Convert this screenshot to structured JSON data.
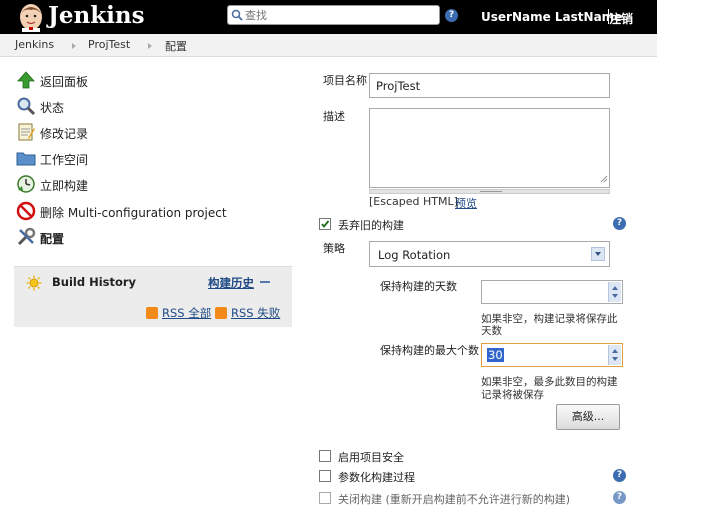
{
  "header": {
    "app_title": "Jenkins",
    "search_placeholder": "查找",
    "user_name": "UserName LastName",
    "logout_label": "注销"
  },
  "breadcrumb": [
    "Jenkins",
    "ProjTest",
    "配置"
  ],
  "sidebar": {
    "items": [
      {
        "label": "返回面板",
        "icon": "up-arrow-icon"
      },
      {
        "label": "状态",
        "icon": "magnifier-icon"
      },
      {
        "label": "修改记录",
        "icon": "notepad-icon"
      },
      {
        "label": "工作空间",
        "icon": "folder-icon"
      },
      {
        "label": "立即构建",
        "icon": "build-clock-icon"
      },
      {
        "label": "删除 Multi-configuration project",
        "icon": "no-entry-icon"
      },
      {
        "label": "配置",
        "icon": "tools-icon"
      }
    ]
  },
  "build_history": {
    "title": "Build History",
    "link_label": "构建历史",
    "rss_all": "RSS 全部",
    "rss_failed": "RSS 失败"
  },
  "form": {
    "project_name_label": "项目名称",
    "project_name_value": "ProjTest",
    "description_label": "描述",
    "description_value": "",
    "escaped_html": "[Escaped HTML]",
    "preview_link": "预览",
    "discard_old_label": "丢弃旧的构建",
    "discard_old_checked": true,
    "strategy_label": "策略",
    "strategy_value": "Log Rotation",
    "days_label": "保持构建的天数",
    "days_value": "",
    "days_note_1": "如果非空，构建记录将保存此",
    "days_note_2": "天数",
    "max_label": "保持构建的最大个数",
    "max_value": "30",
    "max_note_1": "如果非空，最多此数目的构建",
    "max_note_2": "记录将被保存",
    "advanced_button": "高级...",
    "enable_security_label": "启用项目安全",
    "parameterized_label": "参数化构建过程",
    "disable_build_label": "关闭构建 (重新开启构建前不允许进行新的构建)"
  },
  "colors": {
    "header_bg": "#000000",
    "link": "#204a87",
    "help_icon": "#3d6db0",
    "rss": "#f28a1a"
  }
}
